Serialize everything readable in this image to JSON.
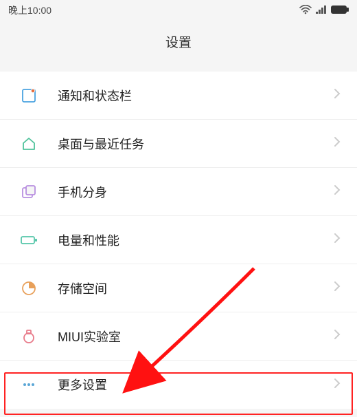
{
  "status": {
    "time": "晚上10:00"
  },
  "header": {
    "title": "设置"
  },
  "rows": [
    {
      "icon": "notify-icon",
      "label": "通知和状态栏"
    },
    {
      "icon": "home-icon",
      "label": "桌面与最近任务"
    },
    {
      "icon": "clone-icon",
      "label": "手机分身"
    },
    {
      "icon": "battery-icon",
      "label": "电量和性能"
    },
    {
      "icon": "storage-icon",
      "label": "存储空间"
    },
    {
      "icon": "lab-icon",
      "label": "MIUI实验室"
    },
    {
      "icon": "more-icon",
      "label": "更多设置"
    }
  ]
}
